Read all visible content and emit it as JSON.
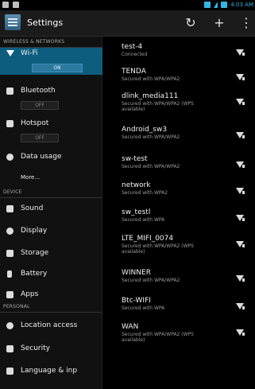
{
  "status_bar": {
    "time": "4:03 AM"
  },
  "action_bar": {
    "title": "Settings"
  },
  "sections": [
    "WIRELESS & NETWORKS",
    "DEVICE",
    "PERSONAL"
  ],
  "nav": {
    "wifi": {
      "label": "Wi-Fi",
      "toggle": "ON"
    },
    "bluetooth": {
      "label": "Bluetooth",
      "toggle": "OFF"
    },
    "hotspot": {
      "label": "Hotspot",
      "toggle": "OFF"
    },
    "data_usage": {
      "label": "Data usage"
    },
    "more": {
      "label": "More..."
    },
    "sound": {
      "label": "Sound"
    },
    "display": {
      "label": "Display"
    },
    "storage": {
      "label": "Storage"
    },
    "battery": {
      "label": "Battery"
    },
    "apps": {
      "label": "Apps"
    },
    "location": {
      "label": "Location access"
    },
    "security": {
      "label": "Security"
    },
    "language": {
      "label": "Language & inp"
    }
  },
  "networks": [
    {
      "ssid": "test-4",
      "status": "Connected"
    },
    {
      "ssid": "TENDA",
      "status": "Secured with WPA/WPA2"
    },
    {
      "ssid": "dlink_media111",
      "status": "Secured with WPA/WPA2 (WPS available)"
    },
    {
      "ssid": "Android_sw3",
      "status": "Secured with WPA/WPA2"
    },
    {
      "ssid": "sw-test",
      "status": "Secured with WPA/WPA2"
    },
    {
      "ssid": "network",
      "status": "Secured with WPA2"
    },
    {
      "ssid": "sw_testl",
      "status": "Secured with WPA"
    },
    {
      "ssid": "LTE_MIFI_0074",
      "status": "Secured with WPA/WPA2 (WPS available)"
    },
    {
      "ssid": "WINNER",
      "status": "Secured with WPA/WPA2"
    },
    {
      "ssid": "Btc-WIFI",
      "status": "Secured with WPA"
    },
    {
      "ssid": "WAN",
      "status": "Secured with WPA/WPA2 (WPS available)"
    }
  ]
}
